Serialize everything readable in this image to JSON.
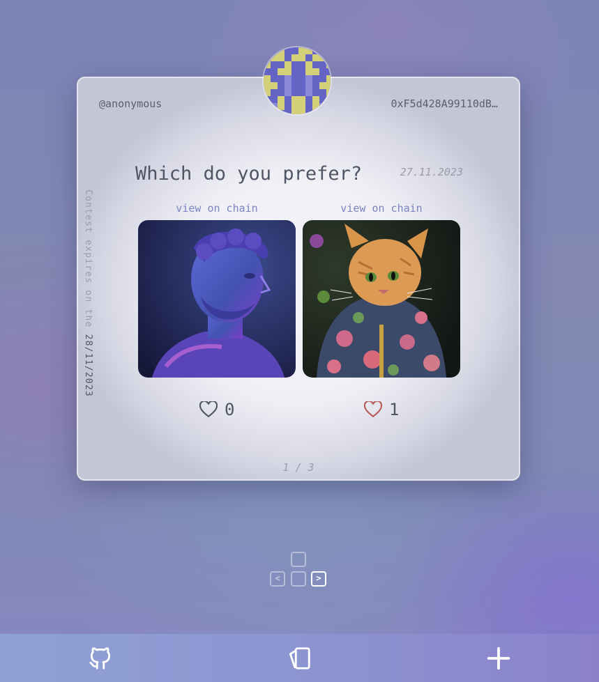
{
  "card": {
    "username": "@anonymous",
    "address": "0xF5d428A99110dB…",
    "question": "Which do you prefer?",
    "date": "27.11.2023",
    "expiry_prefix": "Contest expires on the ",
    "expiry_date": "28/11/2023",
    "pager": "1 / 3"
  },
  "options": [
    {
      "link_label": "view on chain",
      "image": "statue-bust-image",
      "likes": "0",
      "liked": false
    },
    {
      "link_label": "view on chain",
      "image": "cat-in-hoodie-image",
      "likes": "1",
      "liked": true
    }
  ],
  "keyboard_hint": {
    "left": "<",
    "right": ">"
  },
  "bottom_nav": {
    "items": [
      "github-icon",
      "cards-icon",
      "plus-icon"
    ]
  },
  "colors": {
    "heart_liked": "#b85a5a",
    "heart_default": "#4f5565",
    "link": "#7b84c0",
    "avatar_a": "#6563c4",
    "avatar_b": "#d4d07a"
  }
}
